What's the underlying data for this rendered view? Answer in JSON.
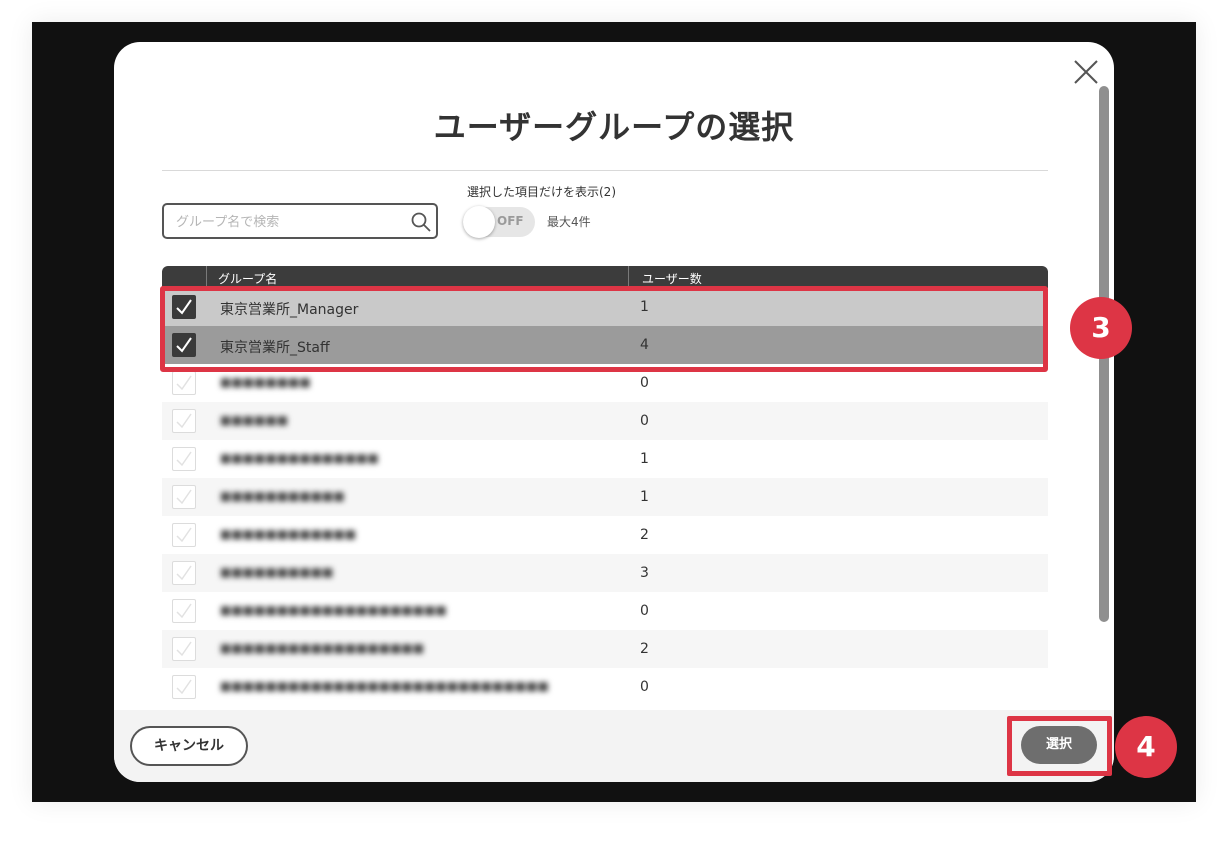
{
  "dialog": {
    "title": "ユーザーグループの選択",
    "search_placeholder": "グループ名で検索",
    "toggle_caption": "選択した項目だけを表示(2)",
    "toggle_state": "OFF",
    "max_label": "最大4件"
  },
  "table": {
    "headers": [
      "グループ名",
      "ユーザー数"
    ],
    "rows": [
      {
        "name": "東京営業所_Manager",
        "count": "1",
        "checked": true
      },
      {
        "name": "東京営業所_Staff",
        "count": "4",
        "checked": true
      },
      {
        "name": "",
        "count": "0",
        "checked": false
      },
      {
        "name": "",
        "count": "0",
        "checked": false
      },
      {
        "name": "",
        "count": "1",
        "checked": false
      },
      {
        "name": "",
        "count": "1",
        "checked": false
      },
      {
        "name": "",
        "count": "2",
        "checked": false
      },
      {
        "name": "",
        "count": "3",
        "checked": false
      },
      {
        "name": "",
        "count": "0",
        "checked": false
      },
      {
        "name": "",
        "count": "2",
        "checked": false
      },
      {
        "name": "",
        "count": "0",
        "checked": false
      }
    ]
  },
  "footer": {
    "cancel_label": "キャンセル",
    "select_label": "選択"
  },
  "annotations": {
    "step3": "3",
    "step4": "4"
  },
  "colors": {
    "accent_red": "#dd3545",
    "header_dark": "#3c3c3c",
    "selected_row_1": "#c9c9c9",
    "selected_row_2": "#9b9b9b"
  }
}
